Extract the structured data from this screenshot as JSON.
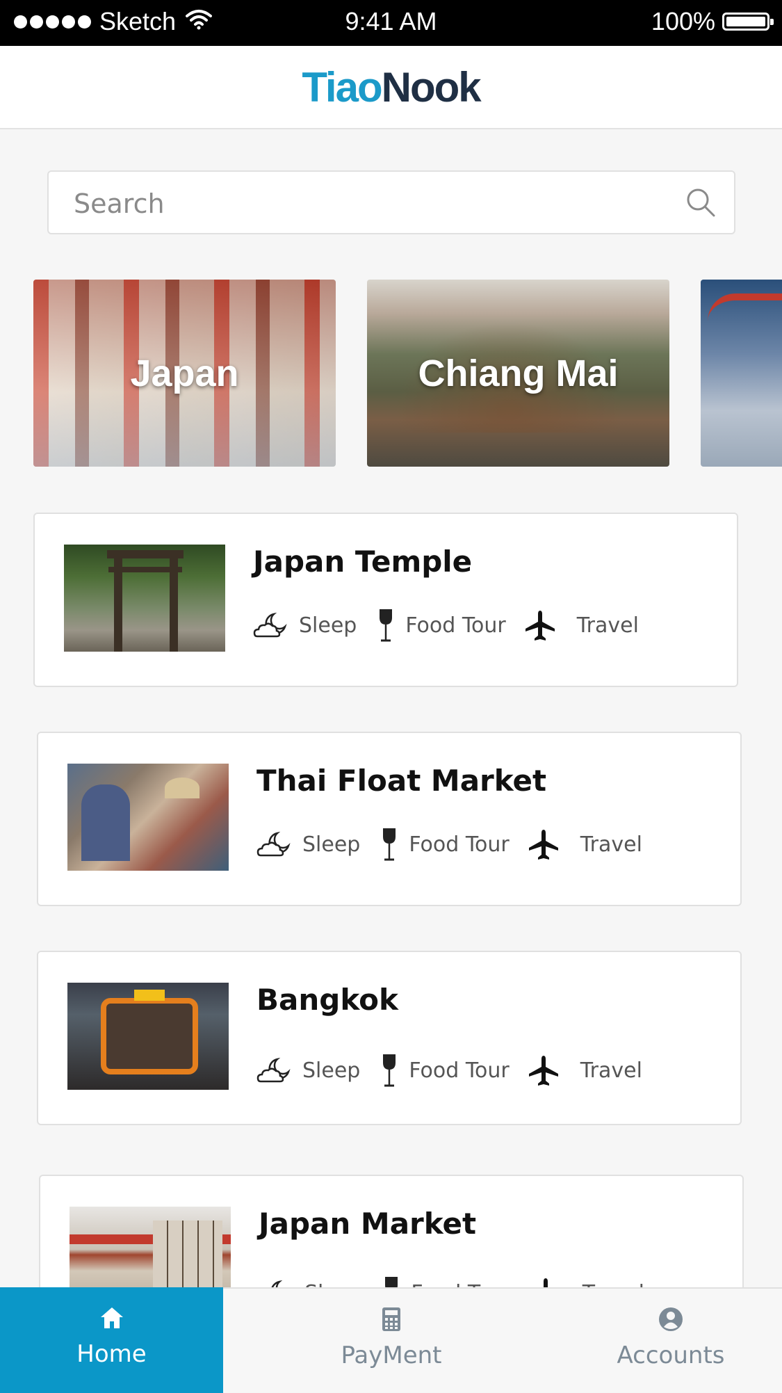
{
  "status_bar": {
    "carrier": "Sketch",
    "time": "9:41 AM",
    "battery": "100%"
  },
  "header": {
    "logo_part1": "Tiao",
    "logo_part2": "Nook"
  },
  "search": {
    "placeholder": "Search",
    "value": ""
  },
  "destinations": [
    {
      "label": "Japan"
    },
    {
      "label": "Chiang Mai"
    },
    {
      "label": ""
    }
  ],
  "tag_labels": {
    "sleep": "Sleep",
    "food": "Food Tour",
    "travel": "Travel"
  },
  "places": [
    {
      "title": "Japan Temple"
    },
    {
      "title": "Thai Float Market"
    },
    {
      "title": "Bangkok"
    },
    {
      "title": "Japan Market"
    }
  ],
  "tabbar": {
    "home": "Home",
    "payment": "PayMent",
    "accounts": "Accounts",
    "active": "home"
  },
  "colors": {
    "brand_blue": "#1b9ac9",
    "brand_dark": "#1f2f44",
    "tab_active_bg": "#0b97c8",
    "tab_inactive": "#7c8a96"
  },
  "icons": {
    "signal": "signal-dots-icon",
    "wifi": "wifi-icon",
    "battery": "battery-icon",
    "search": "search-icon",
    "sleep": "cloud-moon-icon",
    "food": "wine-glass-icon",
    "travel": "airplane-icon",
    "home": "home-icon",
    "payment": "calculator-icon",
    "accounts": "user-icon"
  }
}
